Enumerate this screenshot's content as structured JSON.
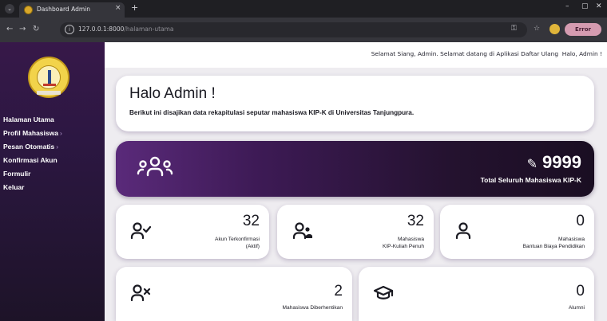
{
  "browser": {
    "tab_title": "Dashboard Admin",
    "tab_close": "×",
    "new_tab": "+",
    "url_host": "127.0.0.1:8000",
    "url_path": "/halaman-utama",
    "error_label": "Error",
    "window_min": "–",
    "window_restore": "▢",
    "window_close": "✕"
  },
  "sidebar": {
    "logo_icon": "university-seal-icon",
    "items": [
      {
        "label": "Halaman Utama",
        "chevron": ""
      },
      {
        "label": "Profil Mahasiswa",
        "chevron": "›"
      },
      {
        "label": "Pesan Otomatis",
        "chevron": "›"
      },
      {
        "label": "Konfirmasi Akun",
        "chevron": ""
      },
      {
        "label": "Formulir",
        "chevron": ""
      },
      {
        "label": "Keluar",
        "chevron": ""
      }
    ]
  },
  "topbar": {
    "greeting": "Selamat Siang, Admin. Selamat datang di Aplikasi Daftar Ulang",
    "user": "Halo, Admin !"
  },
  "hello": {
    "title": "Halo Admin !",
    "subtitle": "Berikut ini disajikan data rekapitulasi seputar mahasiswa KIP-K di Universitas Tanjungpura."
  },
  "total": {
    "value": "9999",
    "label": "Total Seluruh Mahasiswa KIP-K",
    "icon": "users-group-icon",
    "edit_icon": "pencil-icon"
  },
  "stats": [
    {
      "value": "32",
      "label_line1": "Akun Terkonfirmasi",
      "label_line2": "(Aktif)",
      "icon": "user-check-icon"
    },
    {
      "value": "32",
      "label_line1": "Mahasiswa",
      "label_line2": "KIP-Kuliah Penuh",
      "icon": "users-icon"
    },
    {
      "value": "0",
      "label_line1": "Mahasiswa",
      "label_line2": "Bantuan Biaya Pendidikan",
      "icon": "user-icon"
    },
    {
      "value": "2",
      "label_line1": "Mahasiswa Diberhentikan",
      "label_line2": "",
      "icon": "user-x-icon"
    },
    {
      "value": "0",
      "label_line1": "Alumni",
      "label_line2": "",
      "icon": "graduation-cap-icon"
    }
  ],
  "colors": {
    "sidebar": "#2c1742",
    "accent": "#3d1a55",
    "card": "#ffffff"
  }
}
